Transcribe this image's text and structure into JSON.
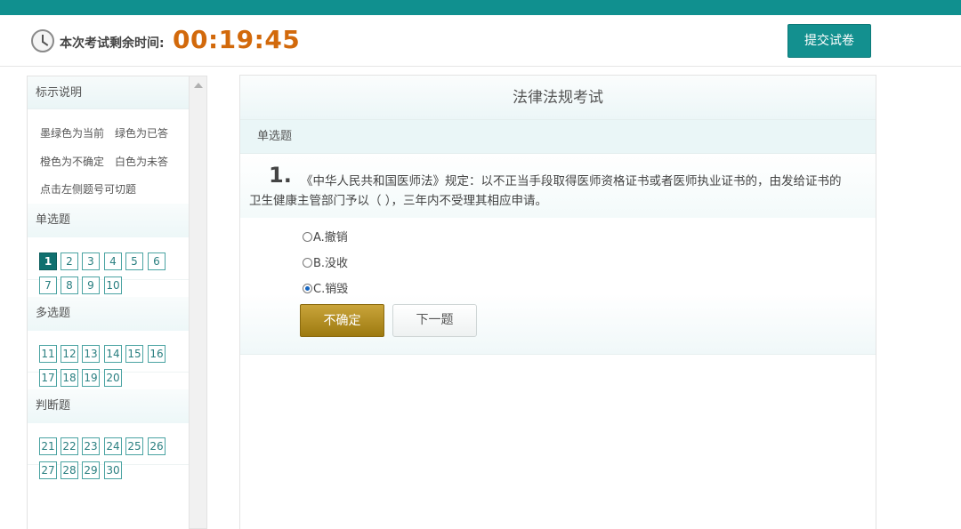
{
  "header": {
    "timer_label": "本次考试剩余时间:",
    "timer_value": "00:19:45",
    "submit_label": "提交试卷"
  },
  "sidebar": {
    "legend_title": "标示说明",
    "legend_lines": [
      "墨绿色为当前　绿色为已答",
      "橙色为不确定　白色为未答",
      "点击左侧题号可切题"
    ],
    "sections": [
      {
        "title": "单选题",
        "numbers": [
          "1",
          "2",
          "3",
          "4",
          "5",
          "6",
          "7",
          "8",
          "9",
          "10"
        ]
      },
      {
        "title": "多选题",
        "numbers": [
          "11",
          "12",
          "13",
          "14",
          "15",
          "16",
          "17",
          "18",
          "19",
          "20"
        ]
      },
      {
        "title": "判断题",
        "numbers": [
          "21",
          "22",
          "23",
          "24",
          "25",
          "26",
          "27",
          "28",
          "29",
          "30"
        ]
      }
    ],
    "current_question": "1"
  },
  "main": {
    "exam_title": "法律法规考试",
    "question_type": "单选题",
    "question_number": "1.",
    "question_text": "《中华人民共和国医师法》规定：以不正当手段取得医师资格证书或者医师执业证书的，由发给证书的卫生健康主管部门予以（ ），三年内不受理其相应申请。",
    "options": [
      {
        "label": "A.撤销",
        "checked": false
      },
      {
        "label": "B.没收",
        "checked": false
      },
      {
        "label": "C.销毁",
        "checked": true
      }
    ],
    "unsure_label": "不确定",
    "next_label": "下一题"
  },
  "colors": {
    "brand_teal": "#10908f",
    "timer_orange": "#d2690b",
    "unsure_gold": "#b08d22",
    "current_dark_green": "#10706f"
  }
}
